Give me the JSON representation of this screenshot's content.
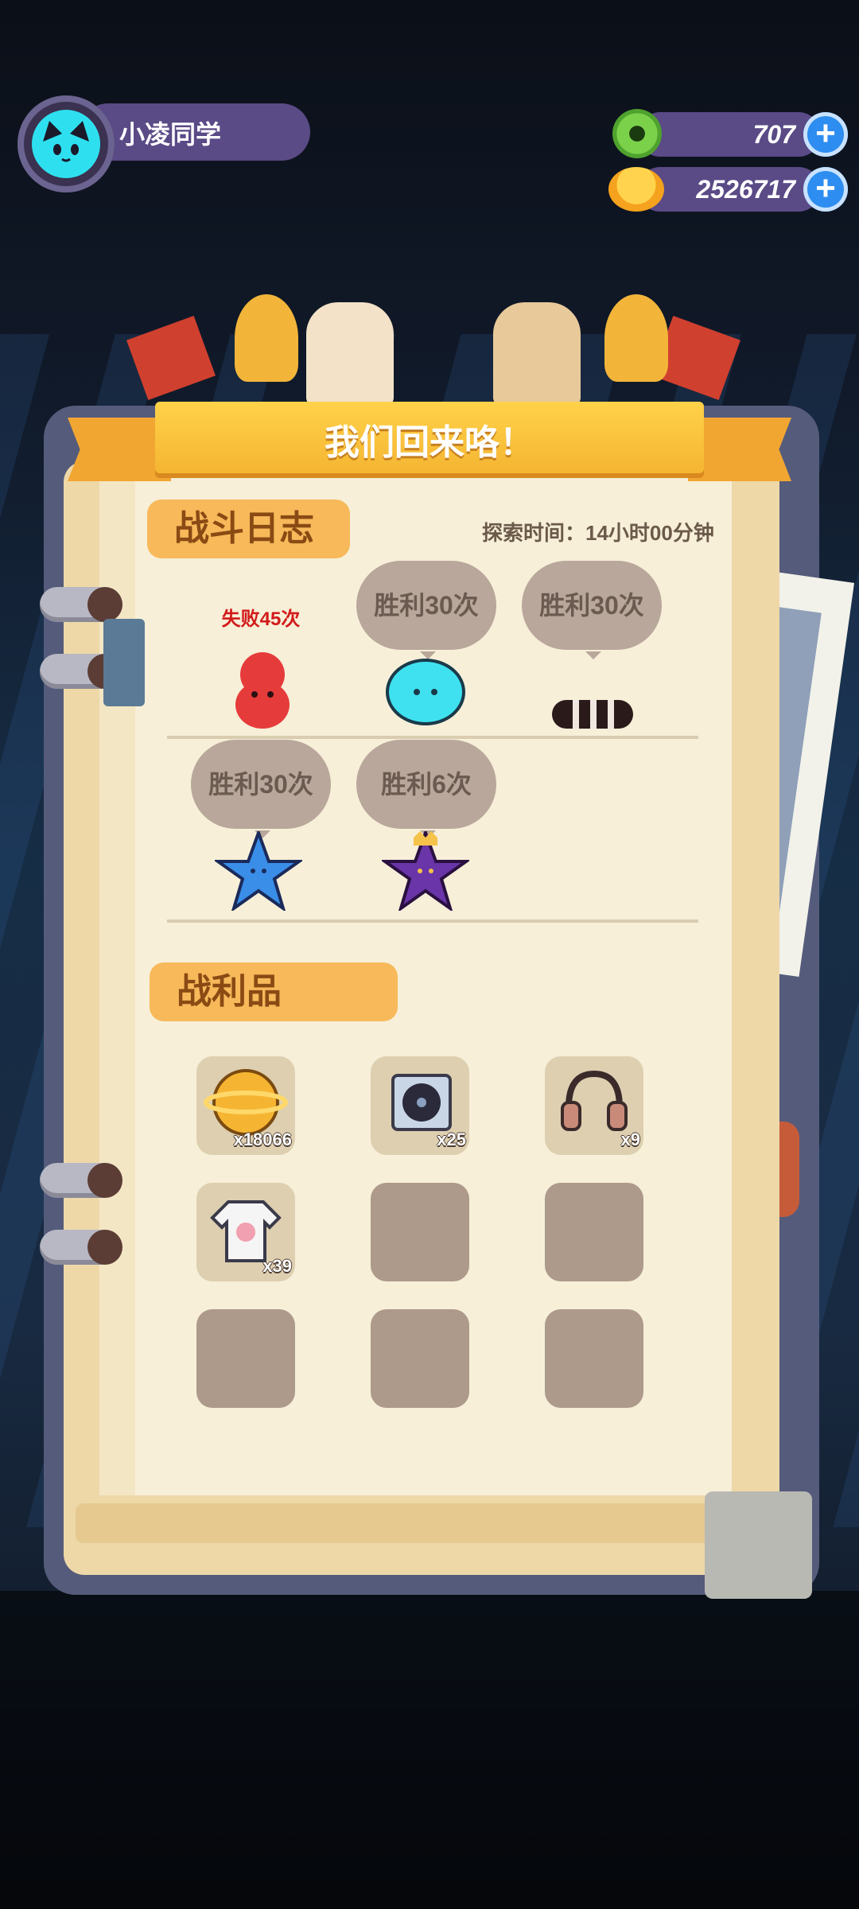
{
  "header": {
    "username": "小凌同学",
    "currencies": [
      {
        "icon": "green-donut-coin-icon",
        "value": "707"
      },
      {
        "icon": "gold-planet-coin-icon",
        "value": "2526717"
      }
    ]
  },
  "dialog": {
    "title": "我们回来咯！",
    "battle_log": {
      "label": "战斗日志",
      "explore_time": "探索时间：14小时00分钟",
      "enemies": [
        {
          "icon": "red-blob-enemy-icon",
          "result": "失败45次",
          "outcome": "lose"
        },
        {
          "icon": "cyan-jellyfish-enemy-icon",
          "result": "胜利30次",
          "outcome": "win"
        },
        {
          "icon": "striped-worm-enemy-icon",
          "result": "胜利30次",
          "outcome": "win"
        },
        {
          "icon": "blue-starfish-enemy-icon",
          "result": "胜利30次",
          "outcome": "win"
        },
        {
          "icon": "purple-crowned-starfish-enemy-icon",
          "result": "胜利6次",
          "outcome": "win"
        }
      ]
    },
    "loot": {
      "label": "战利品",
      "items": [
        {
          "icon": "gold-planet-coin-icon",
          "count": "x18066"
        },
        {
          "icon": "vinyl-record-icon",
          "count": "x25"
        },
        {
          "icon": "headphones-icon",
          "count": "x9"
        },
        {
          "icon": "tshirt-icon",
          "count": "x39"
        },
        {
          "icon": "",
          "count": ""
        },
        {
          "icon": "",
          "count": ""
        },
        {
          "icon": "",
          "count": ""
        },
        {
          "icon": "",
          "count": ""
        },
        {
          "icon": "",
          "count": ""
        }
      ]
    }
  },
  "colors": {
    "banner": "#f5b532",
    "page": "#f7efd8",
    "lose_text": "#d21a1a",
    "bubble": "#b8a79a",
    "empty_slot": "#ad9a8b"
  }
}
